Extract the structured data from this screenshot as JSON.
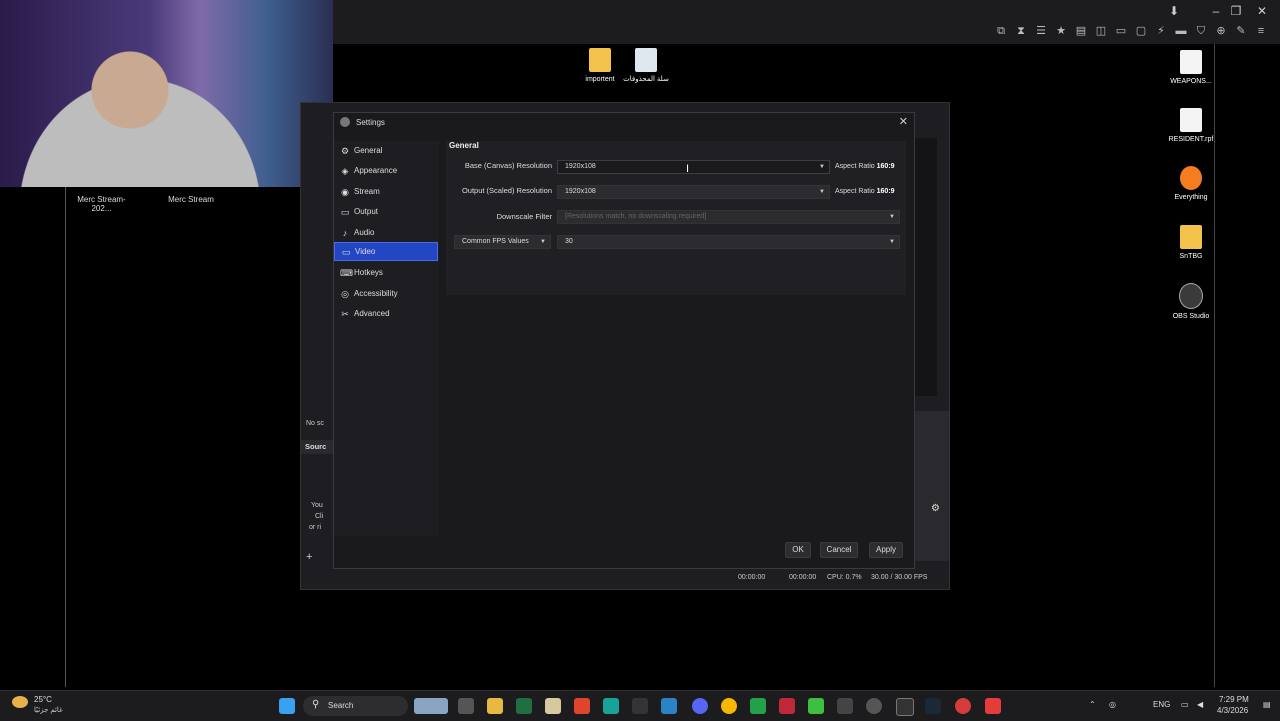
{
  "desktop": {
    "icons_top": [
      {
        "label": "importent"
      },
      {
        "label": "سلة المحذوفات"
      }
    ],
    "icons_right": [
      {
        "label": "WEAPONS..."
      },
      {
        "label": "RESIDENT.rpf"
      },
      {
        "label": "Everything"
      },
      {
        "label": "SnTBG"
      },
      {
        "label": "OBS Studio"
      }
    ]
  },
  "scenes": {
    "items": [
      {
        "label": "Merc Stream-202..."
      },
      {
        "label": "Merc Stream"
      }
    ]
  },
  "obs_main": {
    "fragments": {
      "noscene": "No sc",
      "sources": "Sourc",
      "you": "You",
      "cli": "Cli",
      "or": "or ri"
    },
    "status": {
      "time1": "00:00:00",
      "time2": "00:00:00",
      "cpu": "CPU: 0.7%",
      "fps": "30.00 / 30.00 FPS"
    }
  },
  "settings": {
    "title": "Settings",
    "nav": [
      {
        "label": "General",
        "icon": "gear-icon"
      },
      {
        "label": "Appearance",
        "icon": "appearance-icon"
      },
      {
        "label": "Stream",
        "icon": "stream-icon"
      },
      {
        "label": "Output",
        "icon": "output-icon"
      },
      {
        "label": "Audio",
        "icon": "audio-icon"
      },
      {
        "label": "Video",
        "icon": "video-icon",
        "active": true
      },
      {
        "label": "Hotkeys",
        "icon": "keyboard-icon"
      },
      {
        "label": "Accessibility",
        "icon": "accessibility-icon"
      },
      {
        "label": "Advanced",
        "icon": "wrench-icon"
      }
    ],
    "section": "General",
    "base_label": "Base (Canvas) Resolution",
    "base_value": "1920x108",
    "output_label": "Output (Scaled) Resolution",
    "output_value": "1920x108",
    "aspect_prefix": "Aspect Ratio",
    "aspect_base": "160:9",
    "aspect_output": "160:9",
    "downscale_label": "Downscale Filter",
    "downscale_value": "[Resolutions match, no downscaling required]",
    "fps_type": "Common FPS Values",
    "fps_value": "30",
    "ok": "OK",
    "cancel": "Cancel",
    "apply": "Apply"
  },
  "taskbar": {
    "weather_temp": "25°C",
    "weather_desc": "غائم جزئيًا",
    "search": "Search",
    "lang": "ENG",
    "time": "7:29 PM",
    "date": "4/3/2026"
  }
}
